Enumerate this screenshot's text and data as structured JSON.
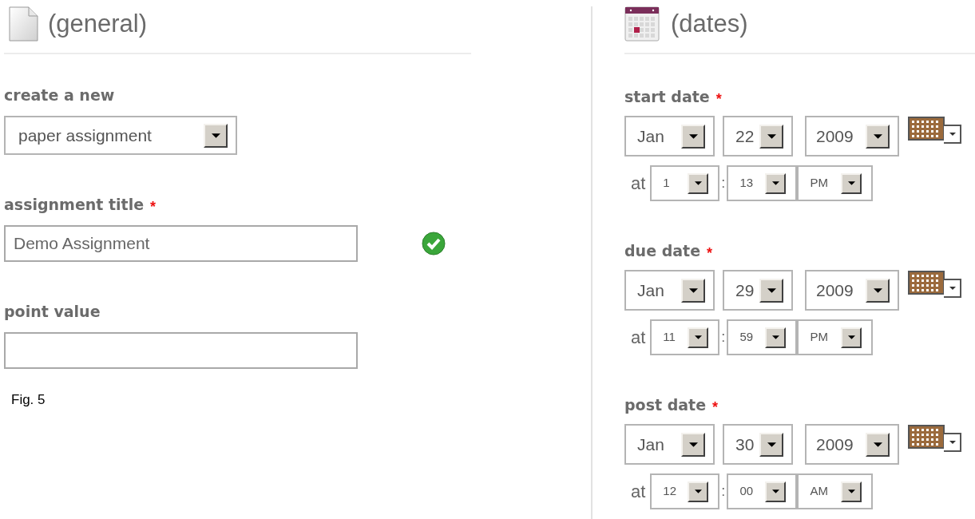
{
  "general": {
    "title": "(general)",
    "fields": [
      {
        "kind": "select",
        "label": "create a new",
        "value": "paper assignment"
      },
      {
        "kind": "text",
        "label": "assignment title",
        "required_mark": "*",
        "value": "Demo Assignment",
        "valid": true
      },
      {
        "kind": "text",
        "label": "point value"
      }
    ],
    "caption": "Fig. 5"
  },
  "dates": {
    "title": "(dates)",
    "groups": [
      {
        "label": "start date",
        "required_mark": "*",
        "month": "Jan",
        "day": "22",
        "year": "2009",
        "at": "at",
        "hour": "1",
        "separator": ":",
        "minute": "13",
        "ampm": "PM"
      },
      {
        "label": "due date",
        "required_mark": "*",
        "month": "Jan",
        "day": "29",
        "year": "2009",
        "at": "at",
        "hour": "11",
        "separator": ":",
        "minute": "59",
        "ampm": "PM"
      },
      {
        "label": "post date",
        "required_mark": "*",
        "month": "Jan",
        "day": "30",
        "year": "2009",
        "at": "at",
        "hour": "12",
        "separator": ":",
        "minute": "00",
        "ampm": "AM"
      }
    ]
  }
}
